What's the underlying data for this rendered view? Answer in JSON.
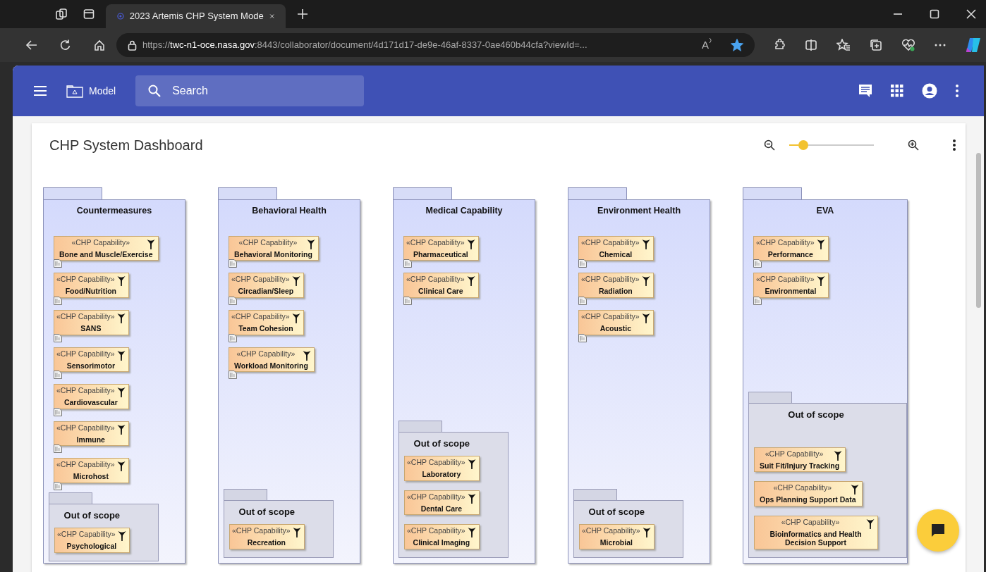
{
  "browser": {
    "tab_title": "2023 Artemis CHP System Mode",
    "url_scheme": "https://",
    "url_host": "twc-n1-oce.nasa.gov",
    "url_rest": ":8443/collaborator/document/4d171d17-de9e-46af-8337-0ae460b44cfa?viewId=...",
    "read_aloud": "A",
    "favorite": true
  },
  "app_bar": {
    "model_label": "Model",
    "search": {
      "placeholder": "Search"
    }
  },
  "dashboard": {
    "title": "CHP System Dashboard",
    "zoom": {
      "level": 0.17
    }
  },
  "packages": [
    {
      "title": "Countermeasures",
      "capabilities": [
        {
          "stereotype": "«CHP Capability»",
          "name": "Bone and Muscle/Exercise",
          "note": true
        },
        {
          "stereotype": "«CHP Capability»",
          "name": "Food/Nutrition",
          "note": true
        },
        {
          "stereotype": "«CHP Capability»",
          "name": "SANS",
          "note": true
        },
        {
          "stereotype": "«CHP Capability»",
          "name": "Sensorimotor",
          "note": true
        },
        {
          "stereotype": "«CHP Capability»",
          "name": "Cardiovascular",
          "note": true
        },
        {
          "stereotype": "«CHP Capability»",
          "name": "Immune",
          "note": true
        },
        {
          "stereotype": "«CHP Capability»",
          "name": "Microhost",
          "note": true
        }
      ],
      "out_of_scope": {
        "title": "Out of scope",
        "capabilities": [
          {
            "stereotype": "«CHP Capability»",
            "name": "Psychological",
            "note": false
          }
        ]
      }
    },
    {
      "title": "Behavioral Health",
      "capabilities": [
        {
          "stereotype": "«CHP Capability»",
          "name": "Behavioral Monitoring",
          "note": true
        },
        {
          "stereotype": "«CHP Capability»",
          "name": "Circadian/Sleep",
          "note": true
        },
        {
          "stereotype": "«CHP Capability»",
          "name": "Team Cohesion",
          "note": true
        },
        {
          "stereotype": "«CHP Capability»",
          "name": "Workload Monitoring",
          "note": true
        }
      ],
      "out_of_scope": {
        "title": "Out of scope",
        "capabilities": [
          {
            "stereotype": "«CHP Capability»",
            "name": "Recreation",
            "note": false
          }
        ]
      }
    },
    {
      "title": "Medical Capability",
      "capabilities": [
        {
          "stereotype": "«CHP Capability»",
          "name": "Pharmaceutical",
          "note": true
        },
        {
          "stereotype": "«CHP Capability»",
          "name": "Clinical Care",
          "note": true
        }
      ],
      "out_of_scope": {
        "title": "Out of scope",
        "capabilities": [
          {
            "stereotype": "«CHP Capability»",
            "name": "Laboratory",
            "note": false
          },
          {
            "stereotype": "«CHP Capability»",
            "name": "Dental Care",
            "note": false
          },
          {
            "stereotype": "«CHP Capability»",
            "name": "Clinical Imaging",
            "note": false
          }
        ]
      }
    },
    {
      "title": "Environment Health",
      "capabilities": [
        {
          "stereotype": "«CHP Capability»",
          "name": "Chemical",
          "note": true
        },
        {
          "stereotype": "«CHP Capability»",
          "name": "Radiation",
          "note": true
        },
        {
          "stereotype": "«CHP Capability»",
          "name": "Acoustic",
          "note": true
        }
      ],
      "out_of_scope": {
        "title": "Out of scope",
        "capabilities": [
          {
            "stereotype": "«CHP Capability»",
            "name": "Microbial",
            "note": false
          }
        ]
      }
    },
    {
      "title": "EVA",
      "capabilities": [
        {
          "stereotype": "«CHP Capability»",
          "name": "Performance",
          "note": true
        },
        {
          "stereotype": "«CHP Capability»",
          "name": "Environmental",
          "note": true
        }
      ],
      "out_of_scope": {
        "title": "Out of scope",
        "capabilities": [
          {
            "stereotype": "«CHP Capability»",
            "name": "Suit Fit/Injury Tracking",
            "note": false
          },
          {
            "stereotype": "«CHP Capability»",
            "name": "Ops Planning Support Data",
            "note": false
          },
          {
            "stereotype": "«CHP Capability»",
            "name": "Bioinformatics and Health Decision Support",
            "note": false
          }
        ]
      }
    }
  ]
}
